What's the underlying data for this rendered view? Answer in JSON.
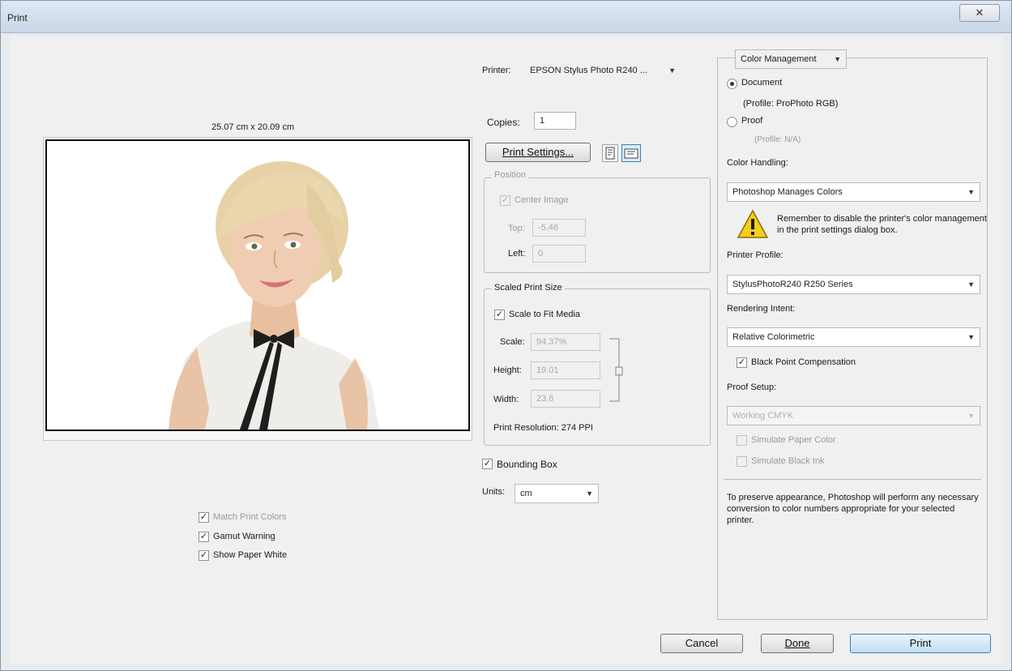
{
  "window": {
    "title": "Print",
    "close_glyph": "✕"
  },
  "preview": {
    "dimensions_label": "25.07 cm x 20.09 cm",
    "options": [
      {
        "label": "Match Print Colors",
        "checked": true
      },
      {
        "label": "Gamut Warning",
        "checked": true
      },
      {
        "label": "Show Paper White",
        "checked": true
      }
    ]
  },
  "printer": {
    "label": "Printer:",
    "value": "EPSON Stylus Photo R240 ...",
    "copies_label": "Copies:",
    "copies_value": "1",
    "print_settings_label": "Print Settings...",
    "portrait_icon": "portrait-icon",
    "landscape_icon": "landscape-icon"
  },
  "position": {
    "legend": "Position",
    "center_label": "Center Image",
    "top_label": "Top:",
    "top_value": "-5.46",
    "left_label": "Left:",
    "left_value": "0"
  },
  "scaled": {
    "legend": "Scaled Print Size",
    "scale_to_fit_label": "Scale to Fit Media",
    "scale_label": "Scale:",
    "scale_value": "94.37%",
    "height_label": "Height:",
    "height_value": "19.01",
    "width_label": "Width:",
    "width_value": "23.6",
    "resolution_label": "Print Resolution: 274 PPI"
  },
  "bounding_box_label": "Bounding Box",
  "units": {
    "label": "Units:",
    "value": "cm"
  },
  "color_mgmt": {
    "section_label": "Color Management",
    "document_label": "Document",
    "document_profile": "(Profile: ProPhoto RGB)",
    "proof_label": "Proof",
    "proof_profile": "(Profile: N/A)",
    "color_handling_label": "Color Handling:",
    "color_handling_value": "Photoshop Manages Colors",
    "warning_text": "Remember to disable the printer's color management in the print settings dialog box.",
    "printer_profile_label": "Printer Profile:",
    "printer_profile_value": "StylusPhotoR240 R250 Series",
    "rendering_intent_label": "Rendering Intent:",
    "rendering_intent_value": "Relative Colorimetric",
    "bpc_label": "Black Point Compensation",
    "proof_setup_label": "Proof Setup:",
    "proof_setup_value": "Working CMYK",
    "simulate_paper_label": "Simulate Paper Color",
    "simulate_black_label": "Simulate Black Ink",
    "description": "To preserve appearance, Photoshop will perform any necessary conversion to color numbers appropriate for your selected printer."
  },
  "buttons": {
    "cancel": "Cancel",
    "done": "Done",
    "print": "Print"
  },
  "colors": {
    "dialog_bg": "#f0f0f0",
    "titlebar": "#c9d6e6",
    "accent": "#3c7fb1"
  }
}
